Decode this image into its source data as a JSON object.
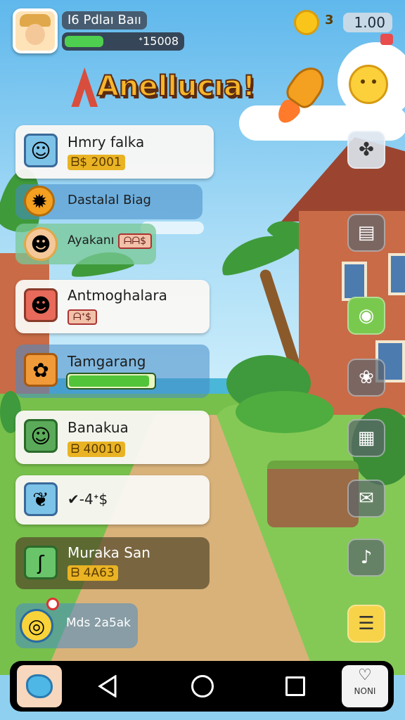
{
  "player": {
    "name": "I6 Pdlaı Baıı",
    "xp_text": "ᐩ15008",
    "xp_progress": 0.33
  },
  "currency": {
    "level": "3",
    "amount": "1.00"
  },
  "title": "Anellucıa!",
  "quests": [
    {
      "name": "Hmry falka",
      "sub": "ᗷ$ 2001"
    },
    {
      "name": "Dastalal Biag"
    },
    {
      "name": "Ayakanı",
      "tag": "ᗩᗩ$"
    },
    {
      "name": "Antmoghalara",
      "tag": "ᗩᐩ$"
    },
    {
      "name": "Tamgarang",
      "progress": 0.95
    },
    {
      "name": "Banakua",
      "sub": "ᗷ 40010"
    },
    {
      "name": "✔-4ᐩ$"
    },
    {
      "name": "Muraka San",
      "sub": "ᗷ 4A63"
    },
    {
      "name": "Mds 2a5ak"
    }
  ],
  "side_buttons": [
    "fruits-icon",
    "chart-icon",
    "eye-icon",
    "flower-icon",
    "map-icon",
    "chat-icon",
    "music-note-icon",
    "scroll-icon"
  ],
  "nav": {
    "fav_label": "NONI"
  },
  "colors": {
    "accent": "#f7b52a",
    "xp_fill": "#4fcf4f",
    "progress_fill": "#52c43a"
  }
}
